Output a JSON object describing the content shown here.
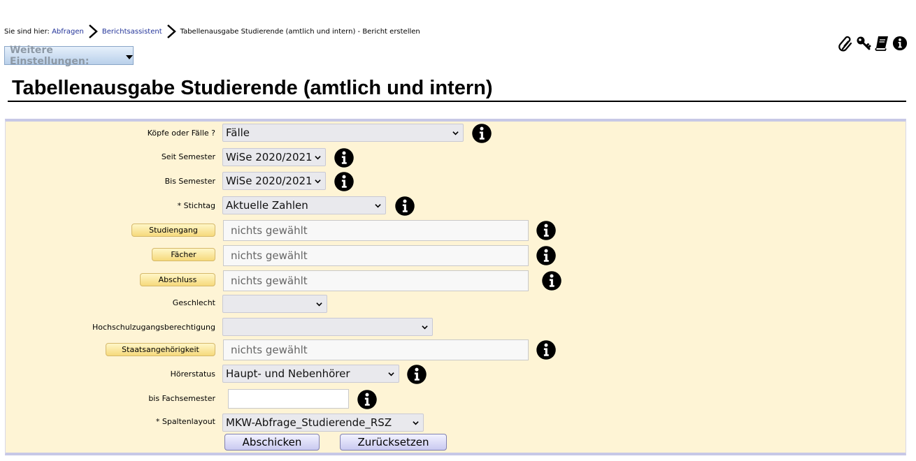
{
  "breadcrumb": {
    "prefix": "Sie sind hier:",
    "items": [
      "Abfragen",
      "Berichtsassistent"
    ],
    "current": "Tabellenausgabe Studierende (amtlich und intern) - Bericht erstellen"
  },
  "header_icons": [
    "paperclip-icon",
    "key-icon",
    "book-icon",
    "info-icon"
  ],
  "settings": {
    "label": "Weitere Einstellungen:"
  },
  "page": {
    "title": "Tabellenausgabe Studierende (amtlich und intern)"
  },
  "form": {
    "koepfe": {
      "label": "Köpfe oder Fälle ?",
      "value": "Fälle"
    },
    "seit_semester": {
      "label": "Seit Semester",
      "value": "WiSe 2020/2021"
    },
    "bis_semester": {
      "label": "Bis Semester",
      "value": "WiSe 2020/2021"
    },
    "stichtag": {
      "label": "* Stichtag",
      "value": "Aktuelle Zahlen"
    },
    "studiengang": {
      "button": "Studiengang",
      "value": "nichts gewählt"
    },
    "faecher": {
      "button": "Fächer",
      "value": "nichts gewählt"
    },
    "abschluss": {
      "button": "Abschluss",
      "value": "nichts gewählt"
    },
    "geschlecht": {
      "label": "Geschlecht",
      "value": ""
    },
    "hzb": {
      "label": "Hochschulzugangsberechtigung",
      "value": ""
    },
    "staatsangehoerigkeit": {
      "button": "Staatsangehörigkeit",
      "value": "nichts gewählt"
    },
    "hoererstatus": {
      "label": "Hörerstatus",
      "value": "Haupt- und Nebenhörer"
    },
    "fachsemester": {
      "label": "bis Fachsemester",
      "value": ""
    },
    "spaltenlayout": {
      "label": "* Spaltenlayout",
      "value": "MKW-Abfrage_Studierende_RSZ"
    }
  },
  "actions": {
    "submit": "Abschicken",
    "reset": "Zurücksetzen"
  }
}
